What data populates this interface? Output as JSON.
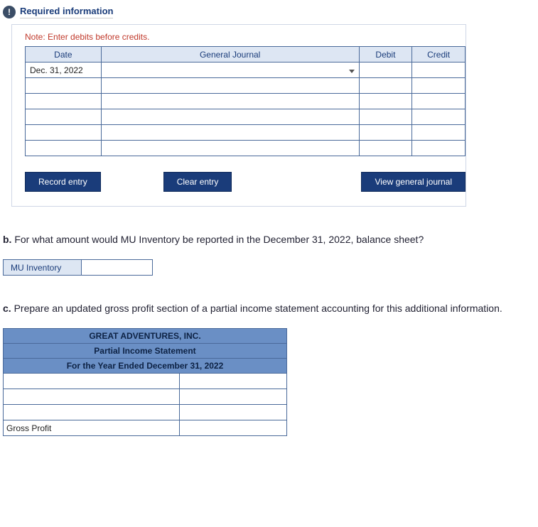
{
  "header": {
    "required_info": "Required information"
  },
  "journal": {
    "note": "Note: Enter debits before credits.",
    "cols": {
      "date": "Date",
      "gj": "General Journal",
      "debit": "Debit",
      "credit": "Credit"
    },
    "rows": [
      {
        "date": "Dec. 31, 2022",
        "gj": "",
        "debit": "",
        "credit": ""
      },
      {
        "date": "",
        "gj": "",
        "debit": "",
        "credit": ""
      },
      {
        "date": "",
        "gj": "",
        "debit": "",
        "credit": ""
      },
      {
        "date": "",
        "gj": "",
        "debit": "",
        "credit": ""
      },
      {
        "date": "",
        "gj": "",
        "debit": "",
        "credit": ""
      },
      {
        "date": "",
        "gj": "",
        "debit": "",
        "credit": ""
      }
    ],
    "buttons": {
      "record": "Record entry",
      "clear": "Clear entry",
      "view": "View general journal"
    }
  },
  "part_b": {
    "prompt_prefix": "b.",
    "prompt": " For what amount would MU Inventory be reported in the December 31, 2022, balance sheet?",
    "label": "MU Inventory",
    "value": ""
  },
  "part_c": {
    "prompt_prefix": "c.",
    "prompt": " Prepare an updated gross profit section of a partial income statement accounting for this additional information.",
    "title1": "GREAT ADVENTURES, INC.",
    "title2": "Partial Income Statement",
    "title3": "For the Year Ended December 31, 2022",
    "rows": [
      {
        "label": "",
        "amount": ""
      },
      {
        "label": "",
        "amount": ""
      },
      {
        "label": "",
        "amount": ""
      }
    ],
    "gross_profit_label": "Gross Profit",
    "gross_profit_amount": ""
  }
}
